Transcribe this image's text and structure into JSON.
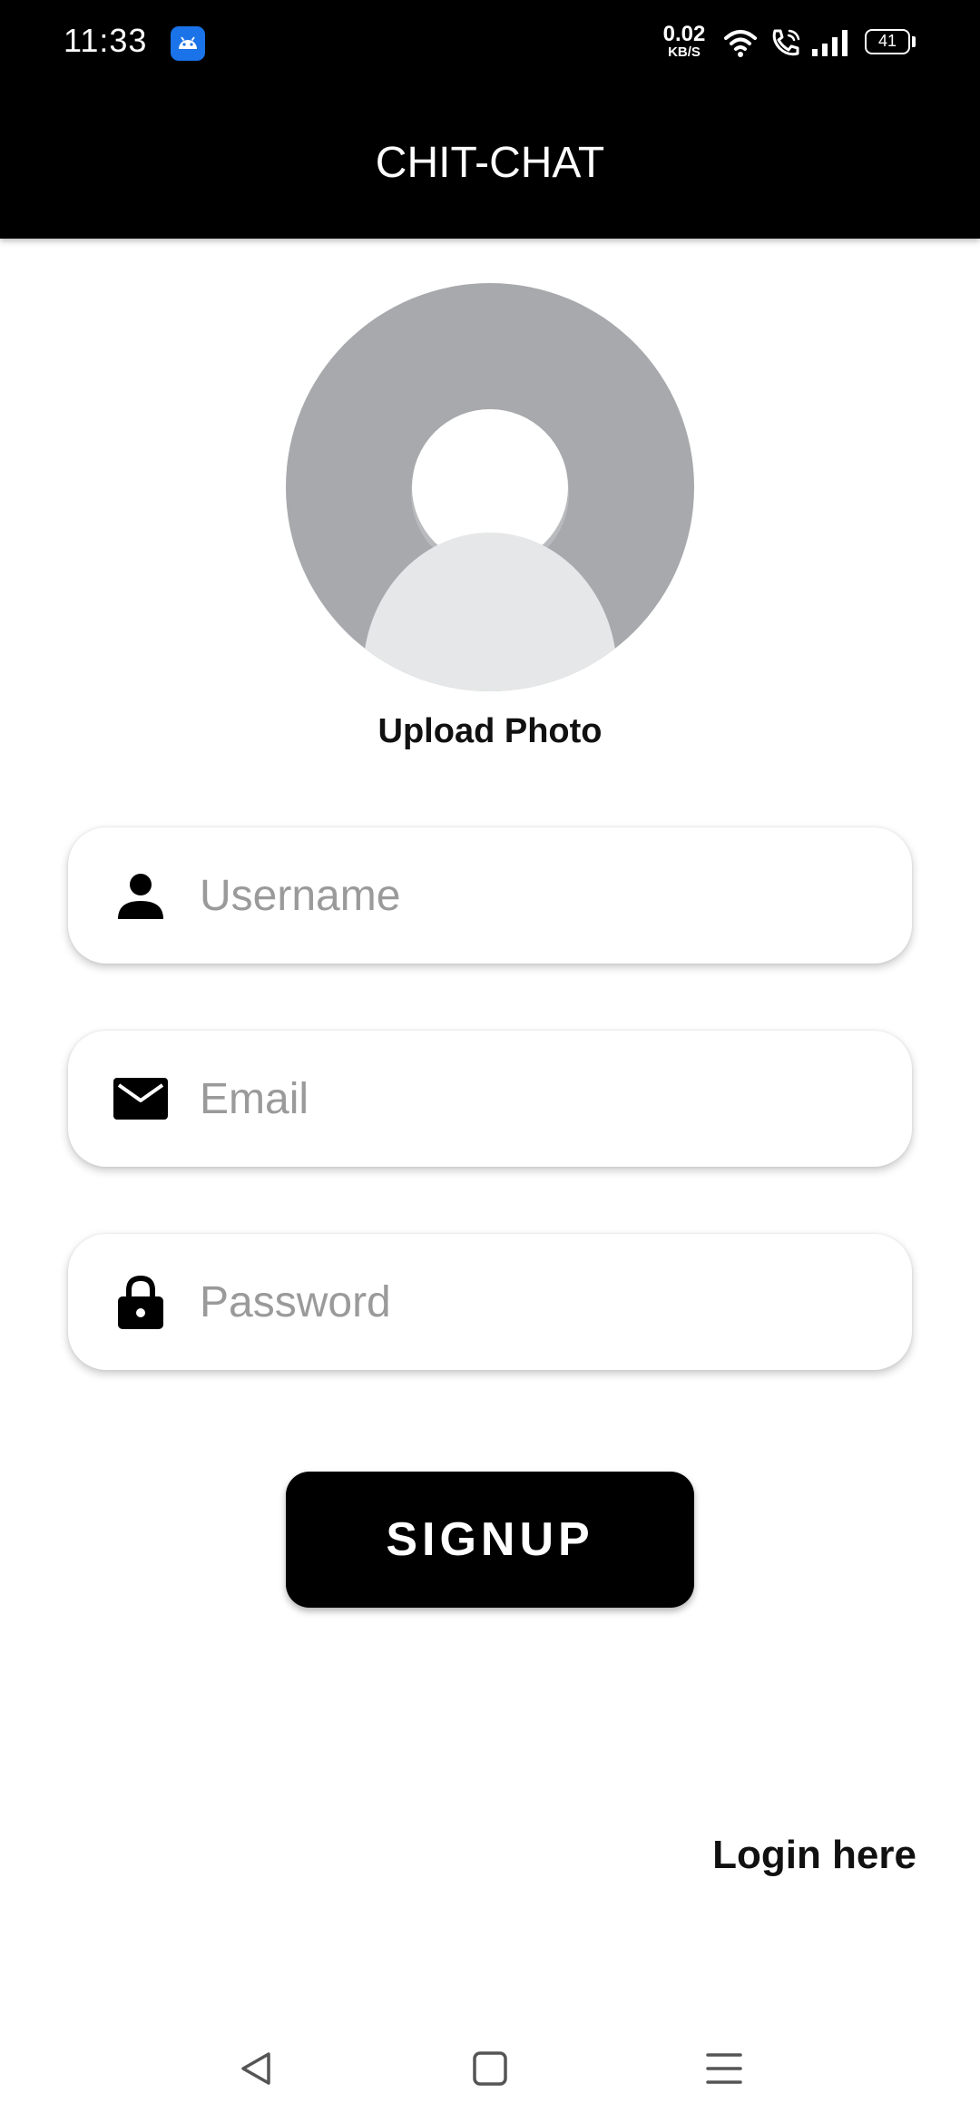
{
  "status_bar": {
    "time": "11:33",
    "net_speed_value": "0.02",
    "net_speed_unit": "KB/S",
    "battery_level": "41",
    "icons": [
      "android-app-icon",
      "wifi-icon",
      "wifi-calling-icon",
      "signal-icon",
      "battery-icon"
    ]
  },
  "header": {
    "title": "CHIT-CHAT"
  },
  "profile": {
    "upload_label": "Upload Photo",
    "avatar_icon": "default-avatar-icon"
  },
  "form": {
    "username": {
      "placeholder": "Username",
      "value": "",
      "icon": "person-icon"
    },
    "email": {
      "placeholder": "Email",
      "value": "",
      "icon": "envelope-icon"
    },
    "password": {
      "placeholder": "Password",
      "value": "",
      "icon": "lock-icon"
    },
    "signup_label": "SIGNUP"
  },
  "footer": {
    "login_link": "Login here"
  },
  "nav": {
    "icons": [
      "back-icon",
      "home-icon",
      "menu-icon"
    ]
  },
  "colors": {
    "header_bg": "#000000",
    "avatar_bg": "#a8a9ac",
    "avatar_fg": "#e6e7e8",
    "placeholder": "#9a9a9a",
    "button_bg": "#000000"
  }
}
